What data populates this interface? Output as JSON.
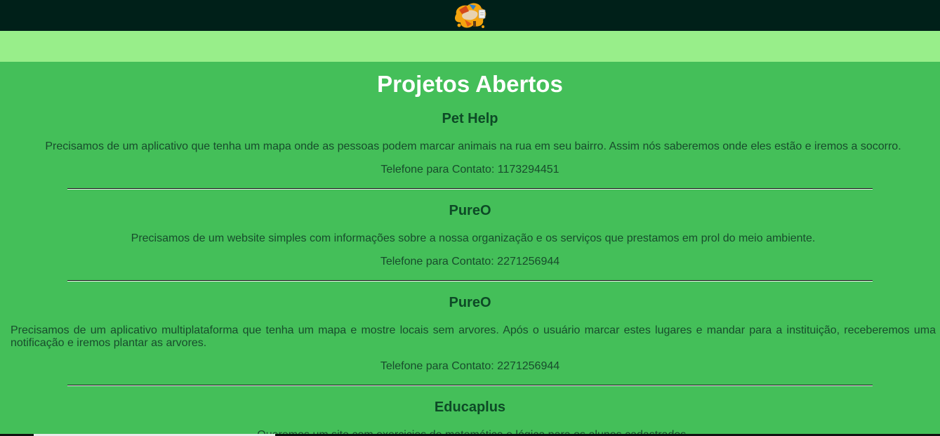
{
  "header": {
    "logo_icon": "paint-splash-logo-icon"
  },
  "main": {
    "title": "Projetos Abertos",
    "projects": [
      {
        "name": "Pet Help",
        "description": "Precisamos de um aplicativo que tenha um mapa onde as pessoas podem marcar animais na rua em seu bairro. Assim nós saberemos onde eles estão e iremos a socorro.",
        "phone": "Telefone para Contato: 1173294451"
      },
      {
        "name": "PureO",
        "description": "Precisamos de um website simples com informações sobre a nossa organização e os serviços que prestamos em prol do meio ambiente.",
        "phone": "Telefone para Contato: 2271256944"
      },
      {
        "name": "PureO",
        "description": "Precisamos de um aplicativo multiplataforma que tenha um mapa e mostre locais sem arvores. Após o usuário marcar estes lugares e mandar para a instituição, receberemos uma notificação e iremos plantar as arvores.",
        "phone": "Telefone para Contato: 2271256944"
      },
      {
        "name": "Educaplus",
        "description": "Queremos um site com exercicios de matemática e lógica para os alunos cadastrados."
      }
    ]
  },
  "colors": {
    "topbar": "#002019",
    "subbar": "#98ee8a",
    "background": "#44bf59",
    "title": "#ffffff",
    "project_name": "#0d4a26",
    "text": "#184c2c"
  }
}
